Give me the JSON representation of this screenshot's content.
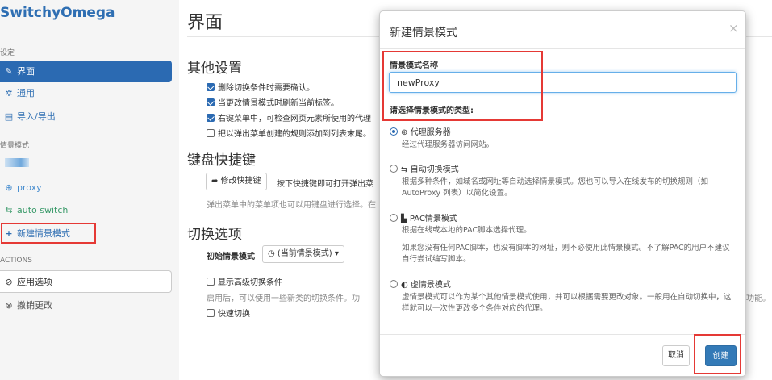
{
  "sidebar": {
    "brand": "SwitchyOmega",
    "section_settings": "设定",
    "items": [
      {
        "label": "界面",
        "icon": "wrench-icon",
        "glyph": "✎"
      },
      {
        "label": "通用",
        "icon": "gear-icon",
        "glyph": "✲"
      },
      {
        "label": "导入/导出",
        "icon": "floppy-disk-icon",
        "glyph": "▤"
      }
    ],
    "section_profiles": "情景模式",
    "profiles": [
      {
        "label": "proxy",
        "icon": "globe-icon",
        "glyph": "⊕"
      },
      {
        "label": "auto switch",
        "icon": "retweet-icon",
        "glyph": "⇆"
      }
    ],
    "new_profile": {
      "label": "新建情景模式",
      "icon": "plus-icon",
      "glyph": "+"
    },
    "section_actions": "ACTIONS",
    "apply": {
      "label": "应用选项",
      "icon": "check-circle-icon",
      "glyph": "⊘"
    },
    "discard": {
      "label": "撤销更改",
      "icon": "undo-icon",
      "glyph": "⊗"
    }
  },
  "main": {
    "title": "界面",
    "misc_heading": "其他设置",
    "checks": [
      {
        "label": "删除切换条件时需要确认。",
        "checked": true
      },
      {
        "label": "当更改情景模式时刷新当前标签。",
        "checked": true
      },
      {
        "label": "右键菜单中，可检查网页元素所使用的代理",
        "checked": true
      },
      {
        "label": "把以弹出菜单创建的规则添加到列表末尾。",
        "checked": false
      }
    ],
    "keyboard_heading": "键盘快捷键",
    "shortcut_button": "修改快捷键",
    "shortcut_text": "按下快捷键即可打开弹出菜",
    "shortcut_desc": "弹出菜单中的菜单项也可以用键盘进行选择。在",
    "switch_heading": "切换选项",
    "initial_label": "初始情景模式",
    "initial_value": "(当前情景模式)",
    "advanced_check": "显示高级切换条件",
    "advanced_desc": "启用后，可以使用一些新类的切换条件。功",
    "advanced_desc_tail": "功能。",
    "quick_switch": "快速切换"
  },
  "modal": {
    "title": "新建情景模式",
    "close": "×",
    "name_label": "情景模式名称",
    "name_value": "newProxy",
    "type_label": "请选择情景模式的类型:",
    "options": [
      {
        "title": "代理服务器",
        "icon": "globe-icon",
        "glyph": "⊕",
        "selected": true,
        "desc": [
          "经过代理服务器访问网站。"
        ]
      },
      {
        "title": "自动切换模式",
        "icon": "retweet-icon",
        "glyph": "⇆",
        "selected": false,
        "desc": [
          "根据多种条件，如域名或网址等自动选择情景模式。您也可以导入在线发布的切换规则（如 AutoProxy 列表）以简化设置。"
        ]
      },
      {
        "title": "PAC情景模式",
        "icon": "file-icon",
        "glyph": "▙",
        "selected": false,
        "desc": [
          "根据在线或本地的PAC脚本选择代理。",
          "如果您没有任何PAC脚本，也没有脚本的网址，则不必使用此情景模式。不了解PAC的用户不建议自行尝试编写脚本。"
        ]
      },
      {
        "title": "虚情景模式",
        "icon": "ghost-icon",
        "glyph": "◐",
        "selected": false,
        "desc": [
          "虚情景模式可以作为某个其他情景模式使用，并可以根据需要更改对象。一般用在自动切换中，这样就可以一次性更改多个条件对应的代理。"
        ]
      }
    ],
    "cancel": "取消",
    "create": "创建"
  },
  "colors": {
    "accent": "#337ab7",
    "annotation_red": "#e53935"
  }
}
